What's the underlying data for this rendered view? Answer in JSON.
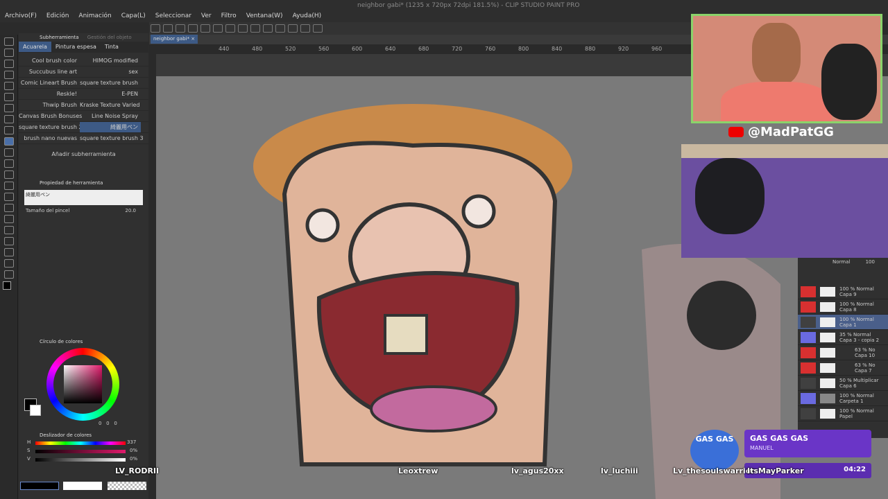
{
  "menu": [
    "Archivo(F)",
    "Edición",
    "Animación",
    "Capa(L)",
    "Seleccionar",
    "Ver",
    "Filtro",
    "Ventana(W)",
    "Ayuda(H)"
  ],
  "window_title": "neighbor gabi* (1235 x 720px 72dpi 181.5%) - CLIP STUDIO PAINT PRO",
  "canvas_tab": "neighbor gabi*",
  "subtool": {
    "panel_title": "Subherramienta",
    "panel_title2": "Gestión del objeto",
    "tabs": [
      "Acuarela",
      "Pintura espesa",
      "Tinta"
    ],
    "brushes": [
      [
        "Cool brush color",
        "HIMOG modified"
      ],
      [
        "Succubus line art",
        "sex"
      ],
      [
        "Comic Lineart Brush",
        "square texture brush"
      ],
      [
        "Reskle!",
        "E-PEN"
      ],
      [
        "Thwip Brush",
        "Kraske Texture Varied"
      ],
      [
        "Canvas Brush Bonuses",
        "Line Noise Spray"
      ],
      [
        "square texture brush 2",
        "綺麗用ペン"
      ],
      [
        "brush nano nuevas",
        "square texture brush 3"
      ]
    ],
    "add_label": "Añadir subherramienta"
  },
  "tool_property": {
    "title": "Propiedad de herramienta",
    "brush_name": "綺麗用ペン",
    "size_label": "Tamaño del pincel",
    "size_value": "20.0"
  },
  "color_circle": {
    "title": "Círculo de colores",
    "values": [
      "0",
      "0",
      "0"
    ]
  },
  "color_slider": {
    "title": "Deslizador de colores",
    "h_label": "H",
    "h_value": "337",
    "s_label": "S",
    "s_value": "0%",
    "v_label": "V",
    "v_value": "0%"
  },
  "ruler_ticks": [
    "440",
    "480",
    "520",
    "560",
    "600",
    "640",
    "680",
    "720",
    "760",
    "800",
    "840",
    "880",
    "920",
    "960"
  ],
  "stream": {
    "handle": "@MadPatGG",
    "now_playing_title": "GAS GAS GAS",
    "now_playing_artist": "MANUEL",
    "logo_text": "GAS GAS",
    "time": "04:22",
    "chat_names": [
      "LV_RODRII",
      "Leoxtrew",
      "lv_agus20xx",
      "lv_luchiii",
      "Lv_thesoulswarrior",
      "ItsMayParker"
    ]
  },
  "layers": {
    "blend_mode": "Normal",
    "opacity": "100",
    "items": [
      {
        "mode": "100 % Normal",
        "name": "Capa 9",
        "color": "#d83030"
      },
      {
        "mode": "100 % Normal",
        "name": "Capa 8",
        "color": "#d83030"
      },
      {
        "mode": "100 % Normal",
        "name": "Capa 1",
        "color": "#404040"
      },
      {
        "mode": "35 % Normal",
        "name": "Capa 3 - copia 2",
        "color": "#6a6ae0"
      },
      {
        "mode": "63 % No",
        "name": "Capa 10",
        "color": "#d83030"
      },
      {
        "mode": "63 % No",
        "name": "Capa 7",
        "color": "#d83030"
      },
      {
        "mode": "50 % Multiplicar",
        "name": "Capa 6",
        "color": "#404040"
      },
      {
        "mode": "100 % Normal",
        "name": "Carpeta 1",
        "color": "#6a6ae0"
      },
      {
        "mode": "100 % Normal",
        "name": "Papel",
        "color": "#404040"
      }
    ]
  },
  "colors": {
    "accent": "#6a35c7",
    "webcam_border": "#8ad36a",
    "selection_pink": "#e01a6b"
  }
}
